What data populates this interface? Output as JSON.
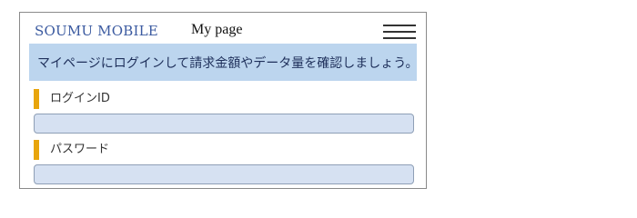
{
  "header": {
    "brand": "SOUMU MOBILE",
    "title": "My page",
    "menu_icon": "hamburger-menu-icon"
  },
  "banner": {
    "text": "マイページにログインして請求金額やデータ量を確認しましょう。"
  },
  "form": {
    "login_id": {
      "label": "ログインID",
      "value": "",
      "placeholder": ""
    },
    "password": {
      "label": "パスワード",
      "value": "",
      "placeholder": ""
    }
  },
  "colors": {
    "brand": "#3b5aa0",
    "banner_bg": "#bcd5ee",
    "label_accent": "#e8a50c",
    "input_bg": "#d6e1f2"
  }
}
